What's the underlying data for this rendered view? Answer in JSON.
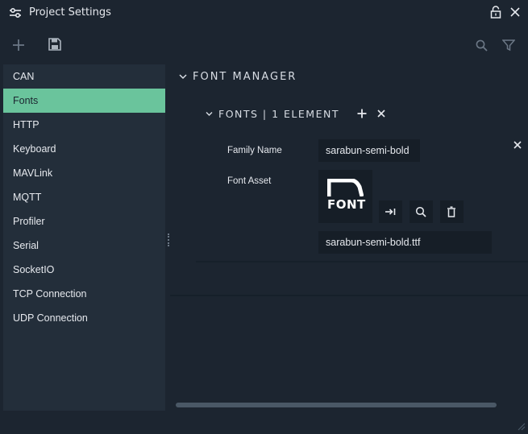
{
  "window": {
    "title": "Project Settings",
    "icons": {
      "title": "sliders-icon",
      "lock": "lock-icon",
      "close": "close-icon"
    }
  },
  "toolbar": {
    "icons": {
      "add": "plus-icon",
      "save": "save-icon",
      "search": "search-icon",
      "filter": "filter-icon"
    }
  },
  "sidebar": {
    "items": [
      {
        "label": "CAN",
        "active": false
      },
      {
        "label": "Fonts",
        "active": true
      },
      {
        "label": "HTTP",
        "active": false
      },
      {
        "label": "Keyboard",
        "active": false
      },
      {
        "label": "MAVLink",
        "active": false
      },
      {
        "label": "MQTT",
        "active": false
      },
      {
        "label": "Profiler",
        "active": false
      },
      {
        "label": "Serial",
        "active": false
      },
      {
        "label": "SocketIO",
        "active": false
      },
      {
        "label": "TCP Connection",
        "active": false
      },
      {
        "label": "UDP Connection",
        "active": false
      }
    ]
  },
  "main": {
    "section_title": "FONT MANAGER",
    "fonts_header": "FONTS | 1 ELEMENT",
    "element": {
      "family_label": "Family Name",
      "family_value": "sarabun-semi-bold",
      "asset_label": "Font Asset",
      "asset_thumb_text": "FONT",
      "asset_file": "sarabun-semi-bold.ttf"
    }
  },
  "colors": {
    "accent": "#6ac49c",
    "background": "#1c2530",
    "panel": "#232e3a",
    "field": "#161e27"
  }
}
